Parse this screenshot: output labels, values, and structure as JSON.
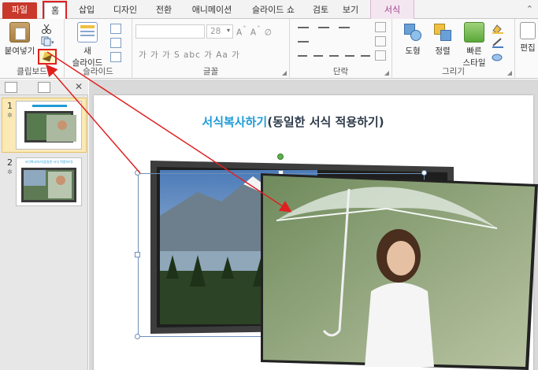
{
  "tabs": {
    "file": "파일",
    "home": "홈",
    "insert": "삽입",
    "design": "디자인",
    "transitions": "전환",
    "animations": "애니메이션",
    "slideshow": "슬라이드 쇼",
    "review": "검토",
    "view": "보기",
    "format": "서식"
  },
  "ribbon": {
    "clipboard": {
      "paste": "붙여넣기",
      "label": "클립보드"
    },
    "slides": {
      "new_slide_line1": "새",
      "new_slide_line2": "슬라이드",
      "label": "슬라이드"
    },
    "font": {
      "size": "28",
      "label": "글꼴"
    },
    "paragraph": {
      "label": "단락"
    },
    "drawing": {
      "shape": "도형",
      "arrange": "정렬",
      "quick_style_line1": "빠른",
      "quick_style_line2": "스타일",
      "label": "그리기"
    },
    "editing": {
      "edit": "편집"
    }
  },
  "panel": {
    "slide1_num": "1",
    "slide2_num": "2",
    "slide2_thumb_title": "서식복사하기(동일한 서식 적용하기)"
  },
  "slide": {
    "title_part1": "서식복사하기",
    "title_part2": "(동일한 서식 적용하기)"
  },
  "colors": {
    "file_tab": "#c8392b",
    "annotation_red": "#e02020",
    "title_blue": "#1f9bd7",
    "title_dark": "#2e3a4a",
    "format_tab": "#a03c8c"
  },
  "icons": [
    "cut-icon",
    "copy-icon",
    "format-painter-icon",
    "paste-icon",
    "new-slide-icon",
    "shape-icon",
    "arrange-icon",
    "quick-style-icon",
    "edit-icon"
  ]
}
